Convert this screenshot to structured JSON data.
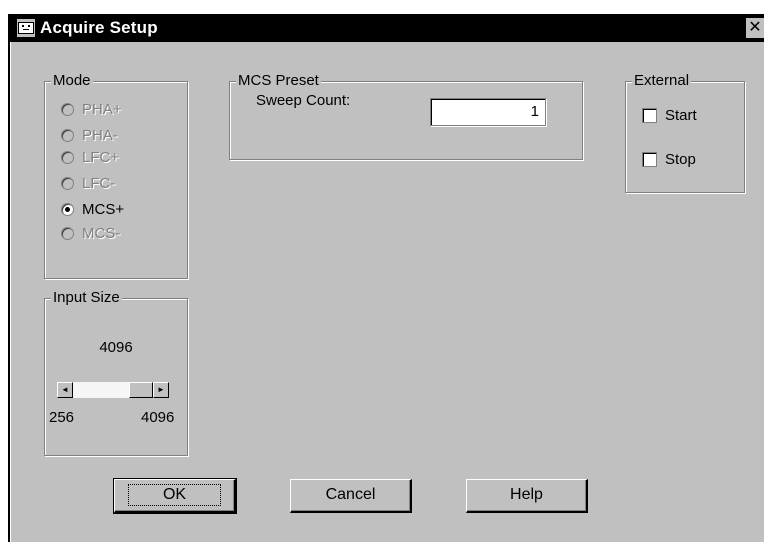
{
  "window": {
    "title": "Acquire Setup",
    "close_glyph": "✕"
  },
  "mode": {
    "legend": "Mode",
    "options": [
      {
        "label": "PHA+",
        "enabled": false,
        "selected": false
      },
      {
        "label": "PHA-",
        "enabled": false,
        "selected": false
      },
      {
        "label": "LFC+",
        "enabled": false,
        "selected": false
      },
      {
        "label": "LFC-",
        "enabled": false,
        "selected": false
      },
      {
        "label": "MCS+",
        "enabled": true,
        "selected": true
      },
      {
        "label": "MCS-",
        "enabled": false,
        "selected": false
      }
    ]
  },
  "mcs_preset": {
    "legend": "MCS Preset",
    "sweep_count_label": "Sweep Count:",
    "sweep_count_value": "1"
  },
  "external": {
    "legend": "External",
    "start_label": "Start",
    "start_checked": false,
    "stop_label": "Stop",
    "stop_checked": false
  },
  "input_size": {
    "legend": "Input Size",
    "value": "4096",
    "min_label": "256",
    "max_label": "4096"
  },
  "buttons": {
    "ok_label": "OK",
    "cancel_label": "Cancel",
    "help_label": "Help"
  },
  "icons": {
    "app": "app-window-icon",
    "scroll_left": "◄",
    "scroll_right": "►"
  }
}
